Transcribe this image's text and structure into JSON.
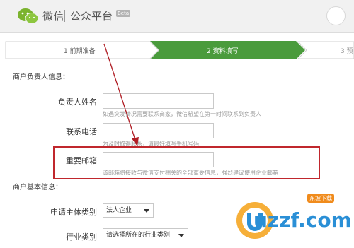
{
  "header": {
    "brand_name": "微信",
    "platform_name": "公众平台",
    "badge": "Beta"
  },
  "steps": [
    {
      "label": "1 前期准备",
      "state": "done"
    },
    {
      "label": "2 资料填写",
      "state": "active"
    },
    {
      "label": "3 预",
      "state": "todo"
    }
  ],
  "colors": {
    "accent_green": "#4a9b3c",
    "highlight_red": "#c0272d",
    "arrow_red": "#b01d24",
    "hint_gray": "#9a9a9a"
  },
  "contact_section": {
    "title": "商户负责人信息：",
    "fields": [
      {
        "label": "负责人姓名",
        "value": "",
        "hint": "如遇突发情况需要联系商家，微信希望在第一时间联系到负责人"
      },
      {
        "label": "联系电话",
        "value": "",
        "hint": "为及时取得联系，请最好填写手机号码"
      },
      {
        "label": "重要邮箱",
        "value": "",
        "hint": "该邮箱将接收与微信支付相关的全部重要信息，强烈建议使用企业邮箱"
      }
    ]
  },
  "basic_section": {
    "title": "商户基本信息：",
    "entity_type": {
      "label": "申请主体类别",
      "selected": "法人企业"
    },
    "industry": {
      "label": "行业类别",
      "selected": "请选择所在的行业类别"
    }
  },
  "watermark": {
    "badge": "东坡下载",
    "text": "uzzf.com"
  },
  "icons": {
    "logo": "wechat-logo-icon",
    "avatar": "user-avatar-icon",
    "dropdown": "chevron-down-icon",
    "annotation": "red-arrow-annotation"
  }
}
